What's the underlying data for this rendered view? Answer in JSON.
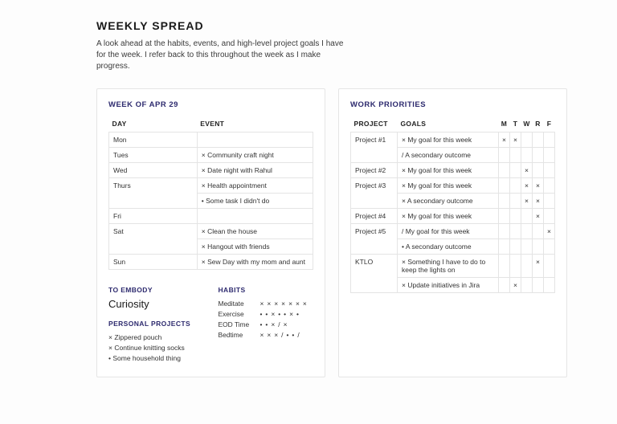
{
  "title": "WEEKLY SPREAD",
  "intro": "A look ahead at the habits, events, and high-level project goals I have for the week. I refer back to this throughout the week as I make progress.",
  "left": {
    "heading": "WEEK OF APR 29",
    "columns": {
      "day": "DAY",
      "event": "EVENT"
    },
    "rows": [
      {
        "day": "Mon",
        "events": [
          ""
        ]
      },
      {
        "day": "Tues",
        "events": [
          "× Community craft night"
        ]
      },
      {
        "day": "Wed",
        "events": [
          "× Date night with Rahul"
        ]
      },
      {
        "day": "Thurs",
        "events": [
          "× Health appointment",
          "• Some task I didn't do"
        ]
      },
      {
        "day": "Fri",
        "events": [
          ""
        ]
      },
      {
        "day": "Sat",
        "events": [
          "× Clean the house",
          "× Hangout with friends"
        ]
      },
      {
        "day": "Sun",
        "events": [
          "× Sew Day with my mom and aunt"
        ]
      }
    ],
    "embody_label": "TO EMBODY",
    "embody_value": "Curiosity",
    "personal_label": "PERSONAL PROJECTS",
    "personal": [
      "× Zippered pouch",
      "× Continue knitting socks",
      "• Some household thing"
    ],
    "habits_label": "HABITS",
    "habits": [
      {
        "name": "Meditate",
        "marks": "× × × × × × ×"
      },
      {
        "name": "Exercise",
        "marks": "• • × • • × •"
      },
      {
        "name": "EOD Time",
        "marks": "• • × / ×"
      },
      {
        "name": "Bedtime",
        "marks": "× × × / • • /"
      }
    ]
  },
  "right": {
    "heading": "WORK PRIORITIES",
    "columns": {
      "project": "PROJECT",
      "goals": "GOALS",
      "days": [
        "M",
        "T",
        "W",
        "R",
        "F"
      ]
    },
    "rows": [
      {
        "project": "Project #1",
        "goals": [
          {
            "text": "× My goal for this week",
            "marks": [
              "×",
              "×",
              "",
              "",
              ""
            ]
          },
          {
            "text": "/ A secondary outcome",
            "marks": [
              "",
              "",
              "",
              "",
              ""
            ]
          }
        ]
      },
      {
        "project": "Project #2",
        "goals": [
          {
            "text": "× My goal for this week",
            "marks": [
              "",
              "",
              "×",
              "",
              ""
            ]
          }
        ]
      },
      {
        "project": "Project #3",
        "goals": [
          {
            "text": "× My goal for this week",
            "marks": [
              "",
              "",
              "×",
              "×",
              ""
            ]
          },
          {
            "text": "× A secondary outcome",
            "marks": [
              "",
              "",
              "×",
              "×",
              ""
            ]
          }
        ]
      },
      {
        "project": "Project #4",
        "goals": [
          {
            "text": "× My goal for this week",
            "marks": [
              "",
              "",
              "",
              "×",
              ""
            ]
          }
        ]
      },
      {
        "project": "Project #5",
        "goals": [
          {
            "text": "/ My goal for this week",
            "marks": [
              "",
              "",
              "",
              "",
              "×"
            ]
          },
          {
            "text": "• A secondary outcome",
            "marks": [
              "",
              "",
              "",
              "",
              ""
            ]
          }
        ]
      },
      {
        "project": "KTLO",
        "goals": [
          {
            "text": "× Something I have to do to keep the lights on",
            "marks": [
              "",
              "",
              "",
              "×",
              ""
            ]
          },
          {
            "text": "× Update initiatives in Jira",
            "marks": [
              "",
              "×",
              "",
              "",
              ""
            ]
          }
        ]
      }
    ]
  }
}
